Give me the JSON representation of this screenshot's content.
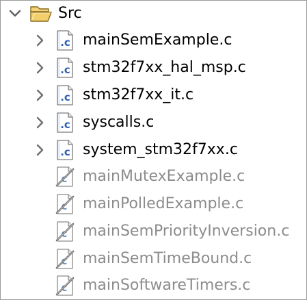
{
  "tree": {
    "folder": {
      "name": "Src",
      "expanded": true,
      "icon": "folder-open-icon"
    },
    "files": [
      {
        "name": "mainSemExample.c",
        "excluded": false,
        "expandable": true,
        "icon": "c-file-icon"
      },
      {
        "name": "stm32f7xx_hal_msp.c",
        "excluded": false,
        "expandable": true,
        "icon": "c-file-icon"
      },
      {
        "name": "stm32f7xx_it.c",
        "excluded": false,
        "expandable": true,
        "icon": "c-file-icon"
      },
      {
        "name": "syscalls.c",
        "excluded": false,
        "expandable": true,
        "icon": "c-file-icon"
      },
      {
        "name": "system_stm32f7xx.c",
        "excluded": false,
        "expandable": true,
        "icon": "c-file-icon"
      },
      {
        "name": "mainMutexExample.c",
        "excluded": true,
        "expandable": false,
        "icon": "excluded-c-file-icon"
      },
      {
        "name": "mainPolledExample.c",
        "excluded": true,
        "expandable": false,
        "icon": "excluded-c-file-icon"
      },
      {
        "name": "mainSemPriorityInversion.c",
        "excluded": true,
        "expandable": false,
        "icon": "excluded-c-file-icon"
      },
      {
        "name": "mainSemTimeBound.c",
        "excluded": true,
        "expandable": false,
        "icon": "excluded-c-file-icon"
      },
      {
        "name": "mainSoftwareTimers.c",
        "excluded": true,
        "expandable": false,
        "icon": "excluded-c-file-icon"
      }
    ]
  },
  "colors": {
    "text": "#000000",
    "excluded_text": "#8c8c8c",
    "chevron": "#5f5f5f",
    "folder": "#e8c15a",
    "c_file_blue": "#2a5fb0"
  }
}
